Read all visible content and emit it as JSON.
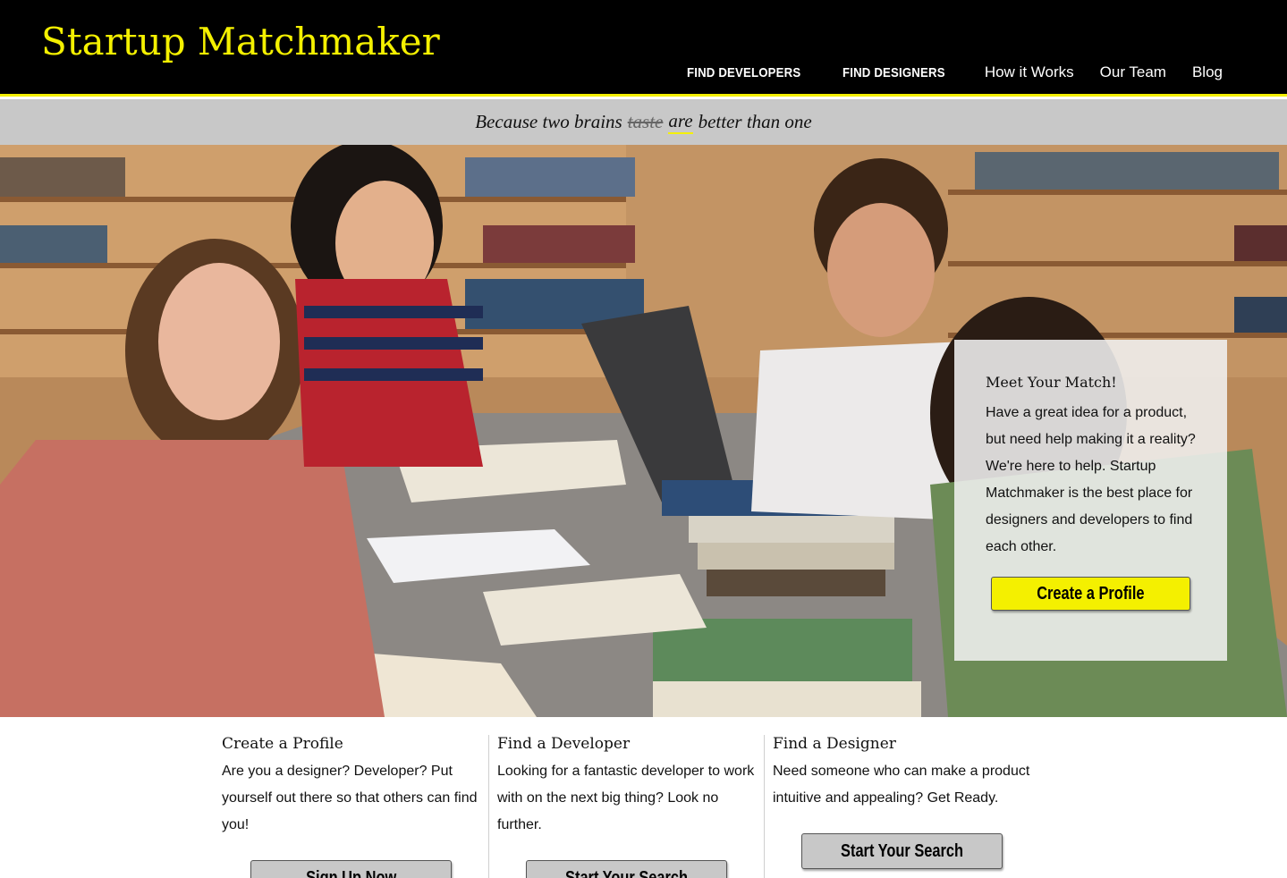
{
  "header": {
    "brand": "Startup Matchmaker",
    "nav": [
      {
        "label": "FIND DEVELOPERS",
        "style": "condensed"
      },
      {
        "label": "FIND DESIGNERS",
        "style": "condensed"
      },
      {
        "label": "How it Works",
        "style": "plain"
      },
      {
        "label": "Our Team",
        "style": "plain"
      },
      {
        "label": "Blog",
        "style": "plain"
      }
    ]
  },
  "tagline": {
    "before": "Because two brains",
    "struck": "taste",
    "underlined": "are",
    "after": "better than one"
  },
  "hero": {
    "card_title": "Meet Your Match!",
    "card_text": "Have a great idea for a product, but need help making it a reality? We're here to help. Startup Matchmaker is the best place for designers and developers to find each other.",
    "cta_label": "Create a Profile"
  },
  "features": [
    {
      "title": "Create a Profile",
      "text": "Are you a designer? Developer? Put yourself out there so that others can find you!",
      "button": "Sign Up Now"
    },
    {
      "title": "Find a Developer",
      "text": "Looking for a fantastic developer to work with on the next big thing? Look no further.",
      "button": "Start Your Search"
    },
    {
      "title": "Find a Designer",
      "text": "Need someone who can make a product intuitive and appealing? Get Ready.",
      "button": "Start Your Search"
    }
  ],
  "colors": {
    "accent": "#f4f000",
    "header_bg": "#000000",
    "tagline_bg": "#c8c8c8",
    "button_gray": "#c8c8c8"
  }
}
